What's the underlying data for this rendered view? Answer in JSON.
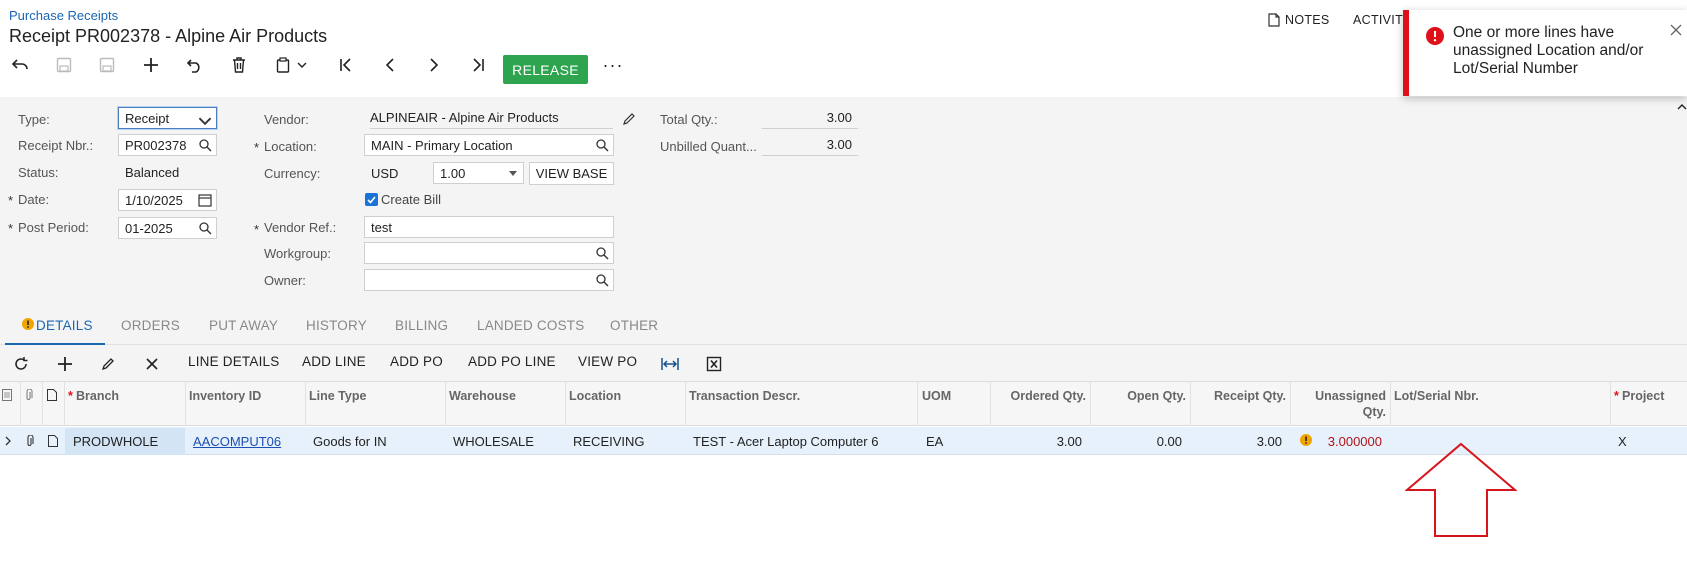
{
  "header": {
    "breadcrumb": "Purchase Receipts",
    "title": "Receipt PR002378 - Alpine Air Products",
    "notes_label": "NOTES",
    "activities_label": "ACTIVITI"
  },
  "toolbar": {
    "release_label": "RELEASE",
    "more_label": "···"
  },
  "form": {
    "type_label": "Type:",
    "type_value": "Receipt",
    "receipt_nbr_label": "Receipt Nbr.:",
    "receipt_nbr_value": "PR002378",
    "status_label": "Status:",
    "status_value": "Balanced",
    "date_label": "Date:",
    "date_value": "1/10/2025",
    "post_period_label": "Post Period:",
    "post_period_value": "01-2025",
    "vendor_label": "Vendor:",
    "vendor_value": "ALPINEAIR - Alpine Air Products",
    "location_label": "Location:",
    "location_value": "MAIN - Primary Location",
    "currency_label": "Currency:",
    "currency_value": "USD",
    "rate_value": "1.00",
    "view_base_label": "VIEW BASE",
    "create_bill_label": "Create Bill",
    "create_bill_checked": true,
    "vendor_ref_label": "Vendor Ref.:",
    "vendor_ref_value": "test",
    "workgroup_label": "Workgroup:",
    "workgroup_value": "",
    "owner_label": "Owner:",
    "owner_value": "",
    "total_qty_label": "Total Qty.:",
    "total_qty_value": "3.00",
    "unbilled_qty_label": "Unbilled Quant...",
    "unbilled_qty_value": "3.00",
    "required_mark": "*"
  },
  "tabs": [
    {
      "label": "DETAILS",
      "active": true
    },
    {
      "label": "ORDERS"
    },
    {
      "label": "PUT AWAY"
    },
    {
      "label": "HISTORY"
    },
    {
      "label": "BILLING"
    },
    {
      "label": "LANDED COSTS"
    },
    {
      "label": "OTHER"
    }
  ],
  "grid_toolbar": {
    "line_details": "LINE DETAILS",
    "add_line": "ADD LINE",
    "add_po": "ADD PO",
    "add_po_line": "ADD PO LINE",
    "view_po": "VIEW PO"
  },
  "grid": {
    "columns": {
      "branch": "Branch",
      "inventory_id": "Inventory ID",
      "line_type": "Line Type",
      "warehouse": "Warehouse",
      "location": "Location",
      "transaction_descr": "Transaction Descr.",
      "uom": "UOM",
      "ordered_qty": "Ordered Qty.",
      "open_qty": "Open Qty.",
      "receipt_qty": "Receipt Qty.",
      "unassigned_qty_1": "Unassigned",
      "unassigned_qty_2": "Qty.",
      "lot_serial": "Lot/Serial Nbr.",
      "project": "Project"
    },
    "rows": [
      {
        "branch": "PRODWHOLE",
        "inventory_id": "AACOMPUT06",
        "line_type": "Goods for IN",
        "warehouse": "WHOLESALE",
        "location": "RECEIVING",
        "transaction_descr": "TEST - Acer Laptop Computer 6",
        "uom": "EA",
        "ordered_qty": "3.00",
        "open_qty": "0.00",
        "receipt_qty": "3.00",
        "unassigned_qty": "3.000000",
        "lot_serial": "",
        "project": "X"
      }
    ]
  },
  "notification": {
    "message": "One or more lines have unassigned Location and/or Lot/Serial Number",
    "type": "error",
    "accent_color": "#e0101a"
  },
  "colors": {
    "brand_blue": "#1a66b3",
    "release_green": "#2ea44f",
    "error_red": "#e0101a"
  }
}
